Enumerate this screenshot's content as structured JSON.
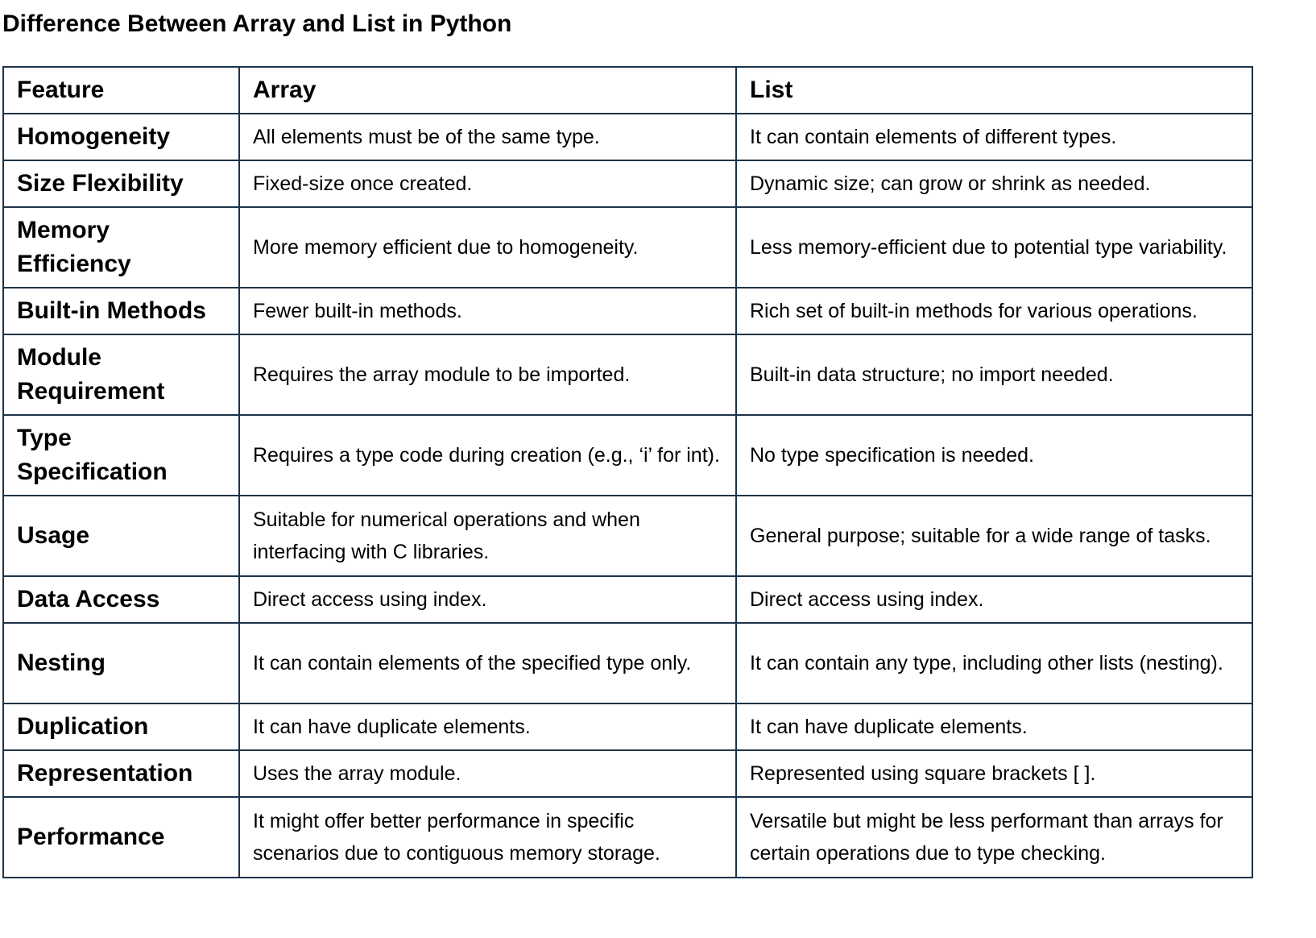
{
  "page": {
    "title": "Difference Between Array and List in Python"
  },
  "table": {
    "headers": [
      "Feature",
      "Array",
      "List"
    ],
    "rows": [
      {
        "feature": "Homogeneity",
        "array": "All elements must be of the same type.",
        "list": "It can contain elements of different types."
      },
      {
        "feature": "Size Flexibility",
        "array": "Fixed-size once created.",
        "list": "Dynamic size; can grow or shrink as needed."
      },
      {
        "feature": "Memory Efficiency",
        "array": "More memory efficient due to homogeneity.",
        "list": "Less memory-efficient due to potential type variability."
      },
      {
        "feature": "Built-in Methods",
        "array": "Fewer built-in methods.",
        "list": "Rich set of built-in methods for various operations."
      },
      {
        "feature": "Module Requirement",
        "array": "Requires the array module to be imported.",
        "list": "Built-in data structure; no import needed."
      },
      {
        "feature": "Type Specification",
        "array": "Requires a type code during creation (e.g., ‘i’ for int).",
        "list": "No type specification is needed."
      },
      {
        "feature": "Usage",
        "array": "Suitable for numerical operations and when interfacing with C libraries.",
        "list": "General purpose; suitable for a wide range of tasks."
      },
      {
        "feature": "Data Access",
        "array": "Direct access using index.",
        "list": "Direct access using index."
      },
      {
        "feature": "Nesting",
        "array": "It can contain elements of the specified type only.",
        "list": "It can contain any type, including other lists (nesting)."
      },
      {
        "feature": "Duplication",
        "array": "It can have duplicate elements.",
        "list": "It can have duplicate elements."
      },
      {
        "feature": "Representation",
        "array": "Uses the array module.",
        "list": "Represented using square brackets [ ]."
      },
      {
        "feature": "Performance",
        "array": "It might offer better performance in specific scenarios due to contiguous memory storage.",
        "list": "Versatile but might be less performant than arrays for certain operations due to type checking."
      }
    ]
  },
  "colors": {
    "border": "#1d3349",
    "text": "#000000",
    "background": "#ffffff"
  }
}
